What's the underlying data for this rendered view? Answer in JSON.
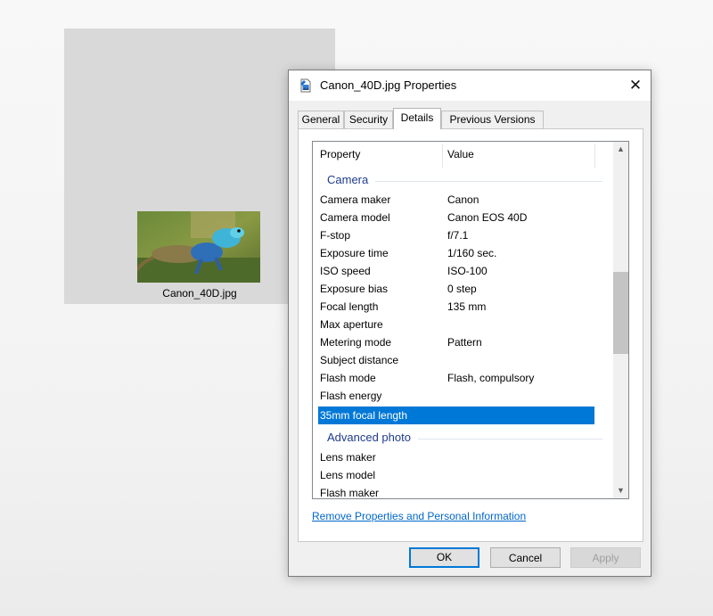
{
  "desktop": {
    "file_caption": "Canon_40D.jpg"
  },
  "dialog": {
    "title": "Canon_40D.jpg Properties",
    "close_glyph": "✕",
    "icon": "image-file-icon",
    "tabs": [
      {
        "label": "General",
        "active": false
      },
      {
        "label": "Security",
        "active": false
      },
      {
        "label": "Details",
        "active": true
      },
      {
        "label": "Previous Versions",
        "active": false
      }
    ],
    "columns": {
      "property": "Property",
      "value": "Value"
    },
    "groups": [
      {
        "title": "Camera",
        "rows": [
          {
            "property": "Camera maker",
            "value": "Canon"
          },
          {
            "property": "Camera model",
            "value": "Canon EOS 40D"
          },
          {
            "property": "F-stop",
            "value": "f/7.1"
          },
          {
            "property": "Exposure time",
            "value": "1/160 sec."
          },
          {
            "property": "ISO speed",
            "value": "ISO-100"
          },
          {
            "property": "Exposure bias",
            "value": "0 step"
          },
          {
            "property": "Focal length",
            "value": "135 mm"
          },
          {
            "property": "Max aperture",
            "value": ""
          },
          {
            "property": "Metering mode",
            "value": "Pattern"
          },
          {
            "property": "Subject distance",
            "value": ""
          },
          {
            "property": "Flash mode",
            "value": "Flash, compulsory"
          },
          {
            "property": "Flash energy",
            "value": ""
          },
          {
            "property": "35mm focal length",
            "value": "",
            "selected": true
          }
        ]
      },
      {
        "title": "Advanced photo",
        "rows": [
          {
            "property": "Lens maker",
            "value": ""
          },
          {
            "property": "Lens model",
            "value": ""
          },
          {
            "property": "Flash maker",
            "value": ""
          }
        ]
      }
    ],
    "scroll_up_glyph": "▲",
    "scroll_down_glyph": "▼",
    "remove_link": "Remove Properties and Personal Information",
    "buttons": {
      "ok": "OK",
      "cancel": "Cancel",
      "apply": "Apply"
    },
    "colors": {
      "selection": "#0078d7",
      "group_title": "#1e3c8c",
      "link": "#0066cc"
    }
  }
}
